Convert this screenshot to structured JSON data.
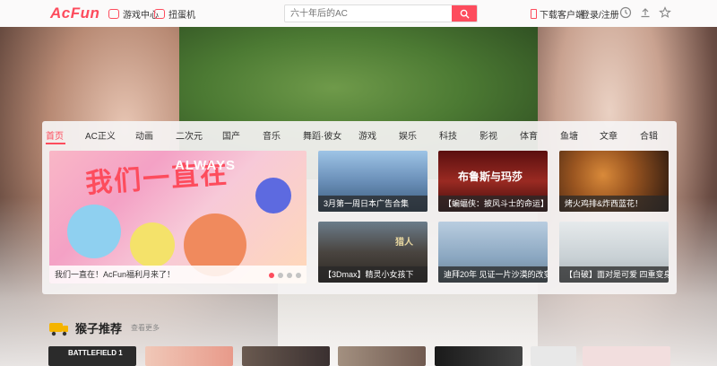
{
  "topbar": {
    "logo": "AcFun",
    "links": [
      {
        "label": "游戏中心"
      },
      {
        "label": "扭蛋机"
      }
    ],
    "search_placeholder": "六十年后的AC",
    "download": "下载客户端",
    "login": "登录/注册"
  },
  "tabs": [
    "首页",
    "AC正义",
    "动画",
    "二次元",
    "国产",
    "音乐",
    "舞蹈·彼女",
    "游戏",
    "娱乐",
    "科技",
    "影视",
    "体育",
    "鱼塘",
    "文章",
    "合辑"
  ],
  "banner": {
    "title": "我们一直在",
    "subtitle": "ALWAYS",
    "caption": "我们一直在！AcFun福利月来了！"
  },
  "tiles": [
    {
      "caption": "3月第一周日本广告合集",
      "color": "#4a6fa0"
    },
    {
      "caption": "【蝙蝠侠：披风斗士的命运】下",
      "color": "#7a1b1b",
      "overlay": "布鲁斯与玛莎"
    },
    {
      "caption": "烤火鸡排&炸西蓝花！",
      "color": "#3b2315"
    },
    {
      "caption": "【3Dmax】精灵小女孩下",
      "color": "#5f5a55",
      "overlay": "猎人"
    },
    {
      "caption": "迪拜20年 见证一片沙漠的改变",
      "color": "#7e9bb6"
    },
    {
      "caption": "【白破】面对是可爱 四重变身",
      "color": "#cfd4d6"
    }
  ],
  "section": {
    "title": "猴子推荐",
    "more": "查看更多"
  },
  "bottom_thumbs": [
    {
      "label": "BATTLEFIELD 1"
    },
    {
      "label": ""
    }
  ],
  "colors": {
    "accent": "#fd4c5d"
  }
}
